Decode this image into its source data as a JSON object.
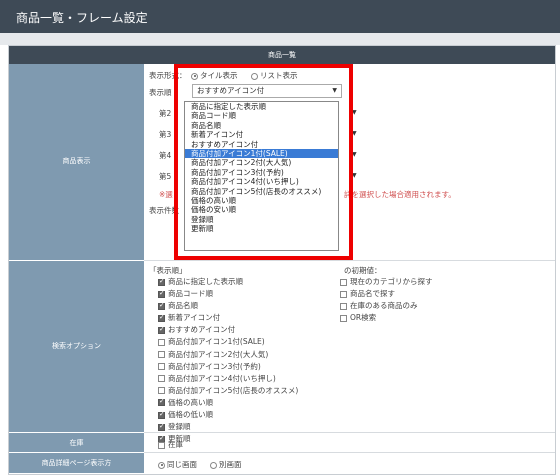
{
  "header": {
    "title": "商品一覧・フレーム設定"
  },
  "table_head": "商品一覧",
  "labels": {
    "display": "商品表示",
    "search": "検索オプション",
    "stock": "在庫",
    "detail": "商品詳細ページ表示方"
  },
  "display": {
    "format_label": "表示形式：",
    "format_tile": "タイル表示",
    "format_list": "リスト表示",
    "order_label": "表示順",
    "order_value": "おすすめアイコン付",
    "rank2": "第2",
    "rank3": "第3",
    "rank4": "第4",
    "rank5": "第5",
    "note_left": "※選",
    "note_right": "詳を選択した場合適用されます。",
    "count_label": "表示件数"
  },
  "order_options": [
    "商品に指定した表示順",
    "商品コード順",
    "商品名順",
    "新着アイコン付",
    "おすすめアイコン付",
    "商品付加アイコン1付(SALE)",
    "商品付加アイコン2付(大人気)",
    "商品付加アイコン3付(予約)",
    "商品付加アイコン4付(いち押し)",
    "商品付加アイコン5付(店長のオススメ)",
    "価格の高い順",
    "価格の安い順",
    "登録順",
    "更新順"
  ],
  "search": {
    "heading": "「表示順」",
    "initial_heading": "の初期値：",
    "sort_items": [
      "商品に指定した表示順",
      "商品コード順",
      "商品名順",
      "新着アイコン付",
      "おすすめアイコン付",
      "商品付加アイコン1付(SALE)",
      "商品付加アイコン2付(大人気)",
      "商品付加アイコン3付(予約)",
      "商品付加アイコン4付(いち押し)",
      "商品付加アイコン5付(店長のオススメ)",
      "価格の高い順",
      "価格の低い順",
      "登録順",
      "更新順"
    ],
    "options": [
      "現在のカテゴリから探す",
      "商品名で探す",
      "在庫のある商品のみ",
      "OR検索"
    ]
  },
  "stock": {
    "option": "在庫"
  },
  "detail": {
    "same": "同じ画面",
    "separate": "別画面"
  }
}
